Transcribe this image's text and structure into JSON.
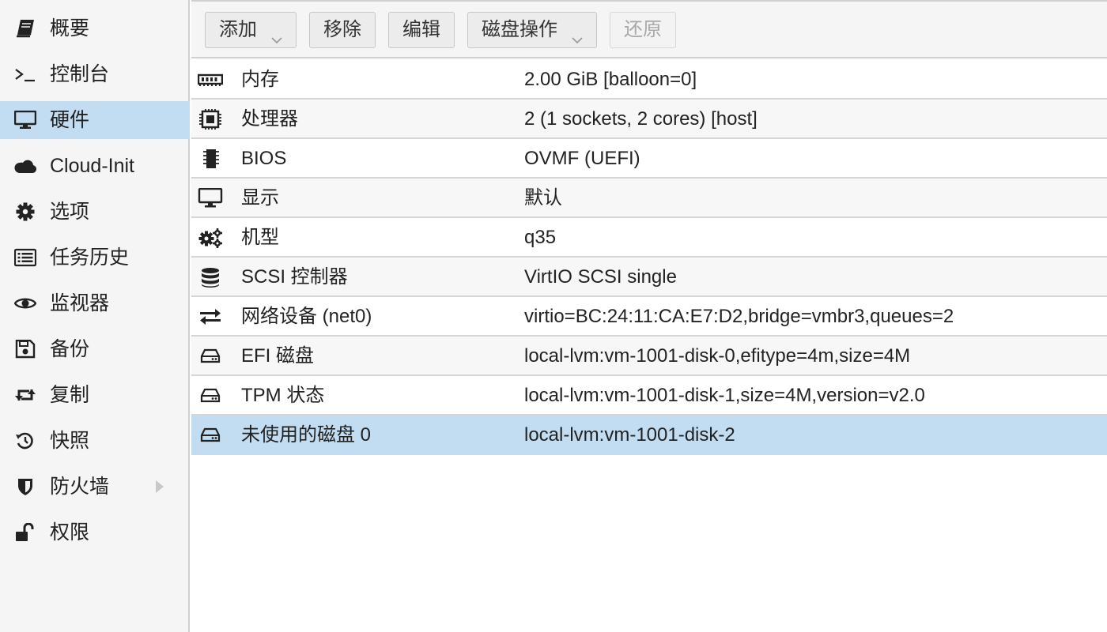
{
  "sidebar": {
    "items": [
      {
        "label": "概要",
        "icon": "book-icon"
      },
      {
        "label": "控制台",
        "icon": "terminal-icon"
      },
      {
        "label": "硬件",
        "icon": "desktop-icon",
        "active": true
      },
      {
        "label": "Cloud-Init",
        "icon": "cloud-icon"
      },
      {
        "label": "选项",
        "icon": "gear-icon"
      },
      {
        "label": "任务历史",
        "icon": "list-icon"
      },
      {
        "label": "监视器",
        "icon": "eye-icon"
      },
      {
        "label": "备份",
        "icon": "floppy-icon"
      },
      {
        "label": "复制",
        "icon": "retweet-icon"
      },
      {
        "label": "快照",
        "icon": "history-icon"
      },
      {
        "label": "防火墙",
        "icon": "shield-icon",
        "has_submenu": true
      },
      {
        "label": "权限",
        "icon": "unlock-icon"
      }
    ]
  },
  "toolbar": {
    "add_label": "添加",
    "remove_label": "移除",
    "edit_label": "编辑",
    "disk_action_label": "磁盘操作",
    "revert_label": "还原"
  },
  "hardware": {
    "rows": [
      {
        "name": "内存",
        "value": "2.00 GiB [balloon=0]",
        "icon": "memory-icon"
      },
      {
        "name": "处理器",
        "value": "2 (1 sockets, 2 cores) [host]",
        "icon": "cpu-icon"
      },
      {
        "name": "BIOS",
        "value": "OVMF (UEFI)",
        "icon": "microchip-icon"
      },
      {
        "name": "显示",
        "value": "默认",
        "icon": "desktop-icon"
      },
      {
        "name": "机型",
        "value": "q35",
        "icon": "cogs-icon"
      },
      {
        "name": "SCSI 控制器",
        "value": "VirtIO SCSI single",
        "icon": "database-icon"
      },
      {
        "name": "网络设备 (net0)",
        "value": "virtio=BC:24:11:CA:E7:D2,bridge=vmbr3,queues=2",
        "icon": "exchange-icon"
      },
      {
        "name": "EFI 磁盘",
        "value": "local-lvm:vm-1001-disk-0,efitype=4m,size=4M",
        "icon": "hdd-icon"
      },
      {
        "name": "TPM 状态",
        "value": "local-lvm:vm-1001-disk-1,size=4M,version=v2.0",
        "icon": "hdd-icon"
      },
      {
        "name": "未使用的磁盘 0",
        "value": "local-lvm:vm-1001-disk-2",
        "icon": "hdd-icon",
        "selected": true
      }
    ]
  },
  "colors": {
    "selection": "#c2ddf2",
    "sidebar_bg": "#f5f5f5",
    "border": "#d0d0d0"
  }
}
